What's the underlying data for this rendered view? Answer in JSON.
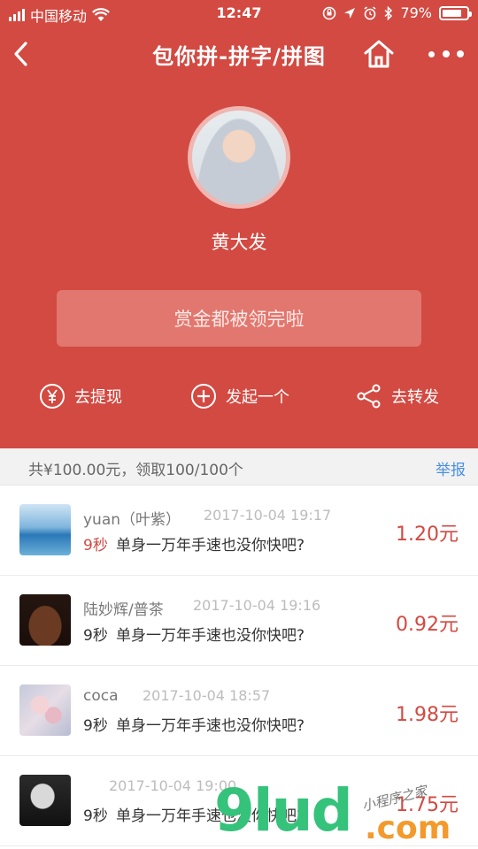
{
  "status_bar": {
    "carrier": "中国移动",
    "time": "12:47",
    "battery": "79%",
    "battery_level": 0.79
  },
  "nav": {
    "title": "包你拼-拼字/拼图"
  },
  "profile": {
    "name": "黄大发"
  },
  "main_button": {
    "label": "赏金都被领完啦"
  },
  "actions": {
    "withdraw": "去提现",
    "create": "发起一个",
    "share": "去转发"
  },
  "summary": {
    "text": "共¥100.00元，领取100/100个",
    "report": "举报"
  },
  "records": [
    {
      "name": "yuan（叶紫）",
      "time": "2017-10-04 19:17",
      "seconds": "9秒",
      "message": "单身一万年手速也没你快吧?",
      "amount": "1.20元"
    },
    {
      "name": "陆妙辉/普茶",
      "time": "2017-10-04 19:16",
      "seconds": "9秒",
      "message": "单身一万年手速也没你快吧?",
      "amount": "0.92元"
    },
    {
      "name": "coca",
      "time": "2017-10-04 18:57",
      "seconds": "9秒",
      "message": "单身一万年手速也没你快吧?",
      "amount": "1.98元"
    },
    {
      "name": "",
      "time": "2017-10-04 19:00",
      "seconds": "9秒",
      "message": "单身一万年手速也没你快吧?",
      "amount": "1.75元"
    }
  ],
  "watermark": {
    "logo": "9lud",
    "domain": ".com",
    "hand": "小程序之家"
  },
  "colors": {
    "primary": "#d24a42",
    "link": "#4a90e2"
  }
}
